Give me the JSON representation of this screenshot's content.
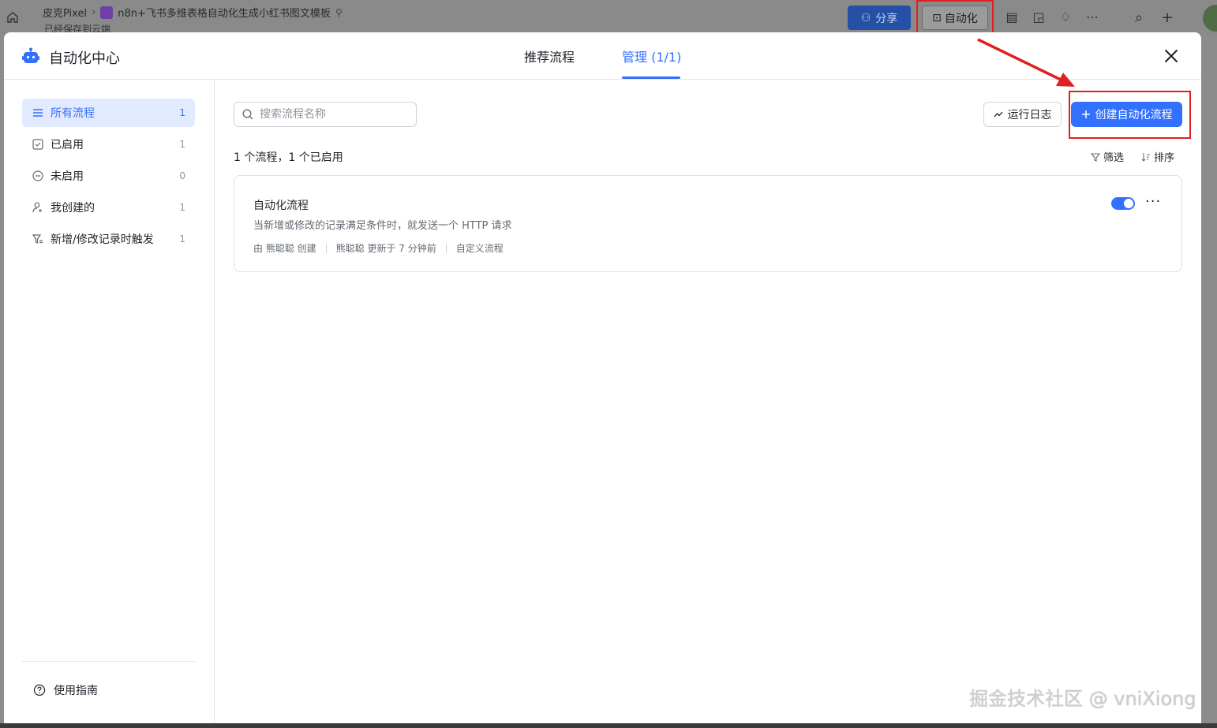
{
  "background": {
    "breadcrumb": {
      "workspace": "皮克Pixel",
      "document": "n8n+飞书多维表格自动化生成小红书图文模板"
    },
    "save_status": "已经保存到云端",
    "share_label": "分享",
    "automation_label": "自动化"
  },
  "modal": {
    "title": "自动化中心",
    "tabs": [
      {
        "label": "推荐流程",
        "active": false
      },
      {
        "label": "管理 (1/1)",
        "active": true
      }
    ]
  },
  "sidebar": {
    "items": [
      {
        "label": "所有流程",
        "count": "1",
        "icon": "list-icon",
        "active": true
      },
      {
        "label": "已启用",
        "count": "1",
        "icon": "checkbox-icon",
        "active": false
      },
      {
        "label": "未启用",
        "count": "0",
        "icon": "minus-circle-icon",
        "active": false
      },
      {
        "label": "我创建的",
        "count": "1",
        "icon": "user-add-icon",
        "active": false
      },
      {
        "label": "新增/修改记录时触发",
        "count": "1",
        "icon": "trigger-filter-icon",
        "active": false
      }
    ],
    "guide_label": "使用指南"
  },
  "main": {
    "search_placeholder": "搜索流程名称",
    "run_log_label": "运行日志",
    "create_label": "创建自动化流程",
    "summary": "1 个流程，1 个已启用",
    "filter_label": "筛选",
    "sort_label": "排序",
    "workflows": [
      {
        "name": "自动化流程",
        "description": "当新增或修改的记录满足条件时，就发送一个 HTTP 请求",
        "creator": "由 熊聪聪 创建",
        "updated": "熊聪聪 更新于 7 分钟前",
        "type": "自定义流程",
        "enabled": true
      }
    ]
  },
  "watermark": "掘金技术社区 @ vniXiong",
  "colors": {
    "accent": "#3370ff",
    "annotation": "#e02020",
    "active_nav_bg": "#e1eaff"
  }
}
